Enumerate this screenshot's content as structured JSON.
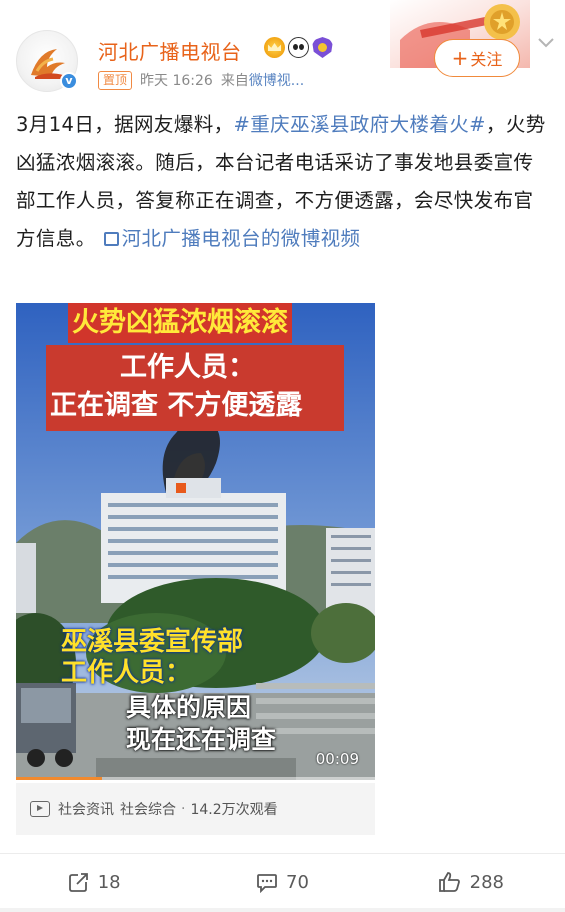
{
  "post": {
    "author": "河北广播电视台",
    "pinned_label": "置顶",
    "time": "昨天 16:26",
    "source_prefix": "来自",
    "source_link": "微博视...",
    "follow_label": "关注",
    "text_part1": "3月14日，据网友爆料，",
    "hashtag": "#重庆巫溪县政府大楼着火#",
    "text_part2": "，火势凶猛浓烟滚滚。随后，本台记者电话采访了事发地县委宣传部工作人员，答复称正在调查，不方便透露，会尽快发布官方信息。",
    "video_link": "河北广播电视台的微博视频"
  },
  "video": {
    "caption_top": "火势凶猛浓烟滚滚",
    "caption_line1": "工作人员：",
    "caption_line2": "正在调查  不方便透露",
    "caption_bottom1": "巫溪县委宣传部",
    "caption_bottom2": "工作人员：",
    "caption_bottom3": "具体的原因",
    "caption_bottom4": "现在还在调查",
    "duration": "00:09",
    "progress": 0.24,
    "tag1": "社会资讯",
    "tag2": "社会综合",
    "separator": "·",
    "views": "14.2万次观看"
  },
  "actions": {
    "reposts": "18",
    "comments": "70",
    "likes": "288"
  },
  "colors": {
    "author_orange": "#e8631a",
    "link_blue": "#4f7cbd",
    "progress_orange": "#f28a2e"
  },
  "icons": [
    "weibo-verified-icon",
    "crown-badge-icon",
    "panda-badge-icon",
    "shield-badge-icon",
    "chevron-down-icon",
    "video-link-icon",
    "play-icon",
    "repost-icon",
    "comment-icon",
    "like-icon"
  ]
}
